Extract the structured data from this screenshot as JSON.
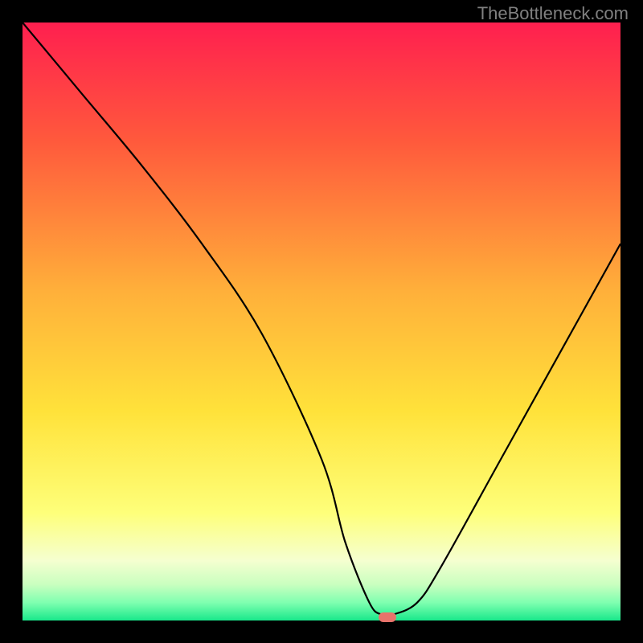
{
  "watermark": "TheBottleneck.com",
  "chart_data": {
    "type": "line",
    "title": "",
    "xlabel": "",
    "ylabel": "",
    "xlim": [
      0,
      100
    ],
    "ylim": [
      0,
      100
    ],
    "series": [
      {
        "name": "bottleneck-curve",
        "x": [
          0,
          10,
          20,
          30,
          40,
          50,
          54,
          58,
          60,
          62,
          66,
          70,
          80,
          90,
          100
        ],
        "values": [
          100,
          88,
          76,
          63,
          48,
          27,
          13,
          3,
          1,
          1,
          3,
          9,
          27,
          45,
          63
        ]
      }
    ],
    "marker": {
      "x": 61,
      "y": 0.5
    },
    "gradient_stops": [
      {
        "pct": 0,
        "color": "#ff1f4f"
      },
      {
        "pct": 20,
        "color": "#ff5a3c"
      },
      {
        "pct": 45,
        "color": "#ffb03a"
      },
      {
        "pct": 65,
        "color": "#ffe23a"
      },
      {
        "pct": 82,
        "color": "#feff7a"
      },
      {
        "pct": 90,
        "color": "#f5ffd0"
      },
      {
        "pct": 94,
        "color": "#c9ffbf"
      },
      {
        "pct": 97,
        "color": "#7fffb0"
      },
      {
        "pct": 100,
        "color": "#19e88b"
      }
    ]
  }
}
